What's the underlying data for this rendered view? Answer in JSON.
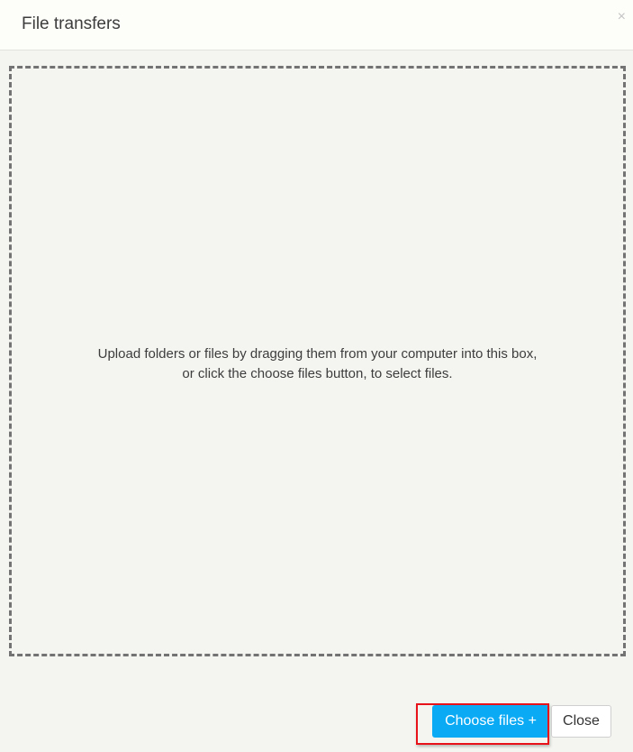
{
  "dialog": {
    "title": "File transfers",
    "close_icon": "×"
  },
  "dropzone": {
    "line1": "Upload folders or files by dragging them from your computer into this box,",
    "line2": "or click the choose files button, to select files."
  },
  "footer": {
    "choose_files_label": "Choose files +",
    "close_label": "Close"
  },
  "colors": {
    "primary": "#0aaaf5",
    "highlight": "#e8121a"
  }
}
